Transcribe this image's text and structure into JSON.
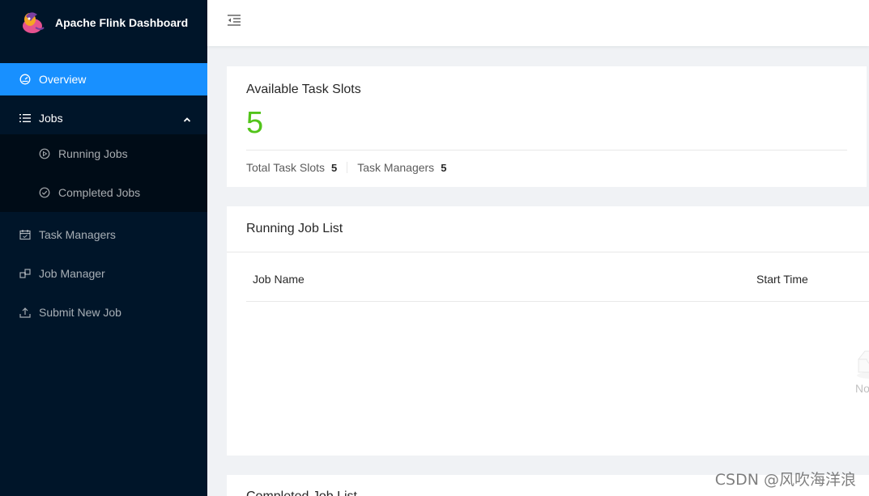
{
  "app": {
    "title": "Apache Flink Dashboard"
  },
  "sidebar": {
    "overview": "Overview",
    "jobs": "Jobs",
    "running_jobs": "Running Jobs",
    "completed_jobs": "Completed Jobs",
    "task_managers": "Task Managers",
    "job_manager": "Job Manager",
    "submit_new_job": "Submit New Job"
  },
  "slots": {
    "title": "Available Task Slots",
    "value": "5",
    "total_label": "Total Task Slots",
    "total_value": "5",
    "tm_label": "Task Managers",
    "tm_value": "5"
  },
  "running": {
    "title": "Running Job List",
    "columns": [
      "Job Name",
      "Start Time"
    ],
    "empty_text": "No"
  },
  "completed": {
    "title": "Completed Job List"
  },
  "watermark": "CSDN @风吹海洋浪",
  "colors": {
    "accent": "#1890ff",
    "success": "#52c41a",
    "sider": "#001529"
  }
}
